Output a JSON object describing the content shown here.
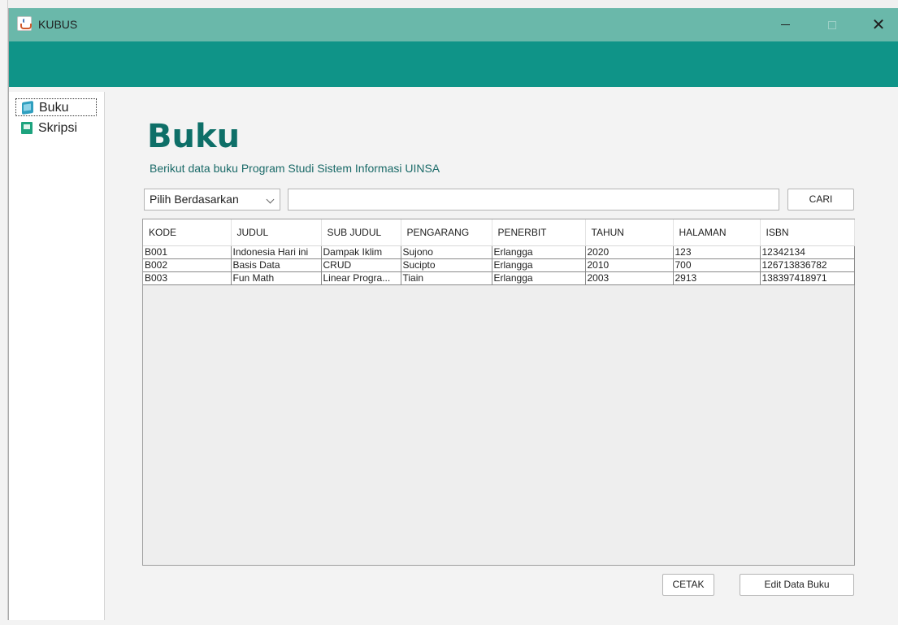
{
  "window": {
    "title": "KUBUS",
    "minimize_glyph": "",
    "close_glyph": "✕"
  },
  "sidebar": {
    "items": [
      {
        "label": "Buku",
        "icon": "book-icon"
      },
      {
        "label": "Skripsi",
        "icon": "thesis-icon"
      }
    ]
  },
  "main": {
    "title": "Buku",
    "subtitle": "Berikut data buku Program Studi Sistem Informasi UINSA",
    "filter": {
      "selected": "Pilih Berdasarkan"
    },
    "search": {
      "value": "",
      "placeholder": ""
    },
    "search_button": "CARI",
    "print_button": "CETAK",
    "edit_button": "Edit Data Buku"
  },
  "table": {
    "columns": [
      "KODE",
      "JUDUL",
      "SUB JUDUL",
      "PENGARANG",
      "PENERBIT",
      "TAHUN",
      "HALAMAN",
      "ISBN"
    ],
    "rows": [
      [
        "B001",
        "Indonesia Hari ini",
        "Dampak Iklim",
        "Sujono",
        "Erlangga",
        "2020",
        "123",
        "12342134"
      ],
      [
        "B002",
        "Basis Data",
        "CRUD",
        "Sucipto",
        "Erlangga",
        "2010",
        "700",
        "126713836782"
      ],
      [
        "B003",
        "Fun Math",
        "Linear Progra...",
        "Tiain",
        "Erlangga",
        "2003",
        "2913",
        "138397418971"
      ]
    ]
  },
  "colors": {
    "titlebar": "#6ab8aa",
    "header_bar": "#0f9488",
    "title_text": "#0e6f68"
  }
}
